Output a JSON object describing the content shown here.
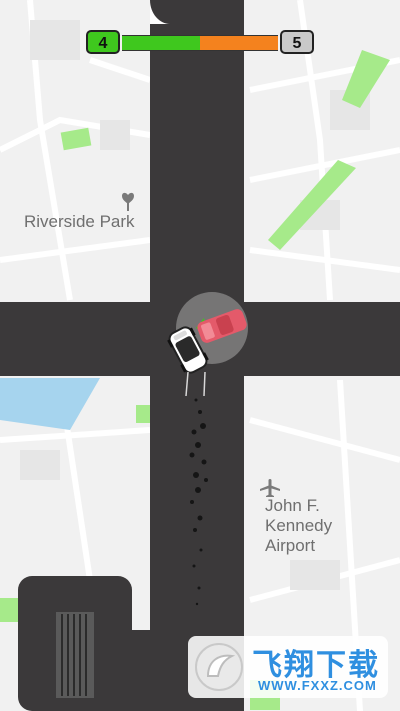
{
  "game": {
    "current_level": "4",
    "next_level": "5",
    "level_progress": 0.5,
    "colors": {
      "progress_done": "#3fc81e",
      "progress_remaining": "#f4821e",
      "road": "#3b393a",
      "player_car": "#ffffff",
      "enemy_car": "#e45a6a",
      "park": "#a6ea8a",
      "water": "#a6d4ee"
    }
  },
  "map": {
    "park_label": "Riverside Park",
    "airport_label": "John F.\nKennedy\nAirport",
    "icons": [
      "park-pin-icon",
      "airplane-icon"
    ]
  },
  "watermark": {
    "title": "飞翔下载",
    "url": "WWW.FXXZ.COM"
  }
}
